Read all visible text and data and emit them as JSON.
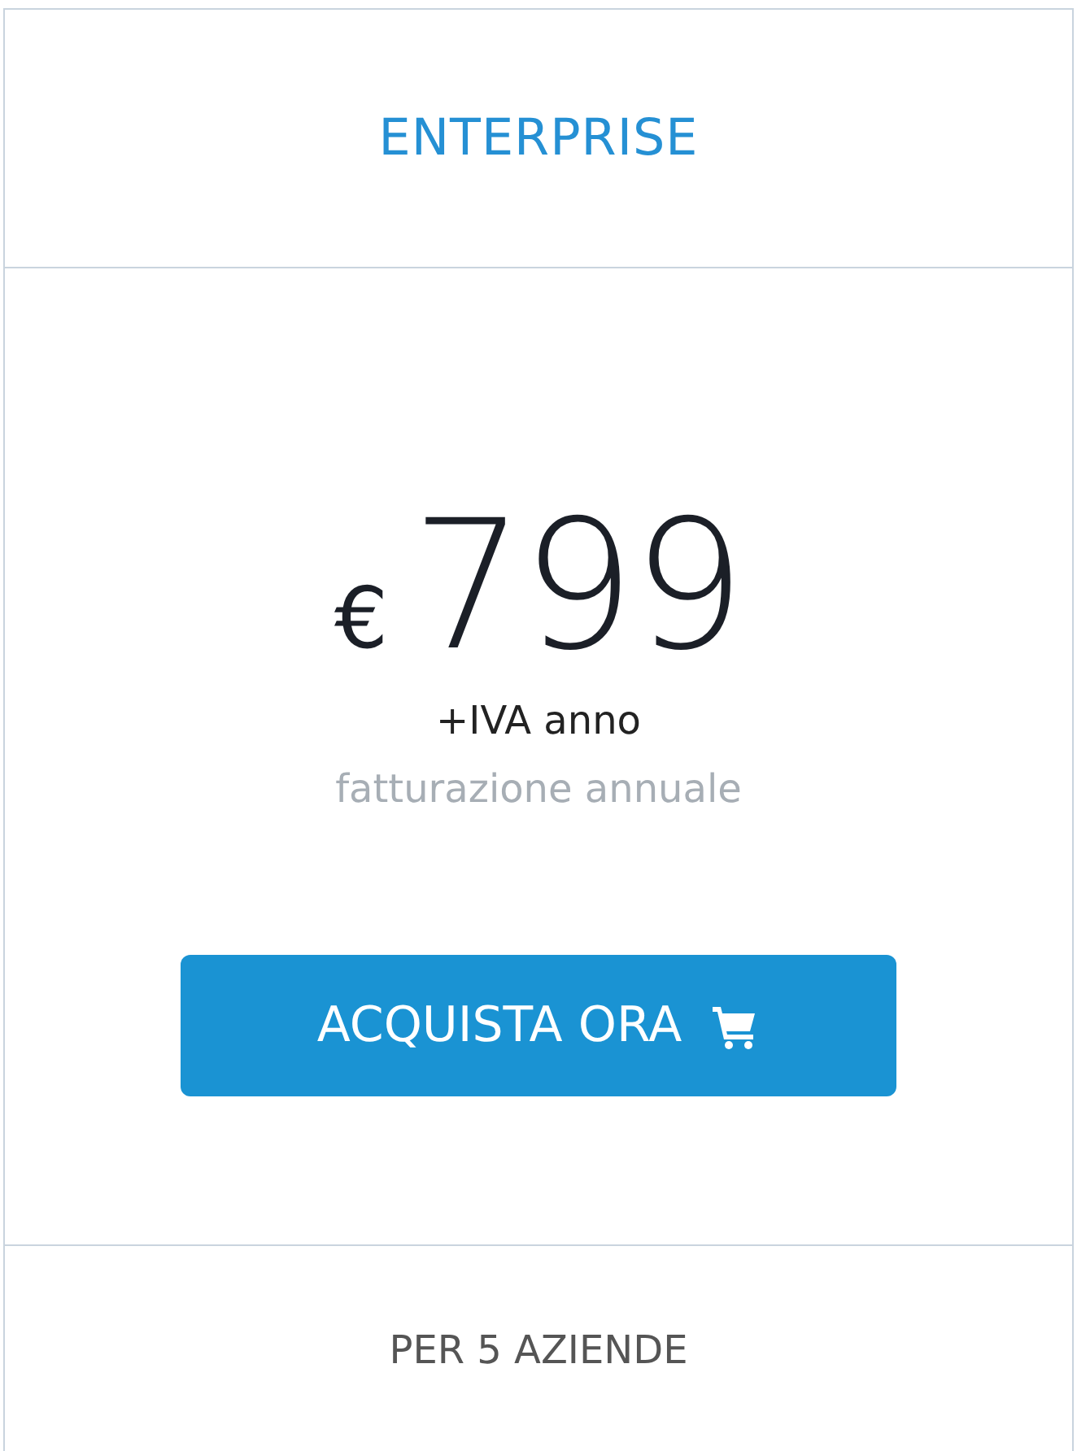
{
  "plan": {
    "name": "ENTERPRISE"
  },
  "price": {
    "currency": "€",
    "amount": "799",
    "suffix": "+IVA anno",
    "billing": "fatturazione annuale"
  },
  "button": {
    "label": "ACQUISTA ORA"
  },
  "footer": {
    "text": "PER 5 AZIENDE"
  }
}
